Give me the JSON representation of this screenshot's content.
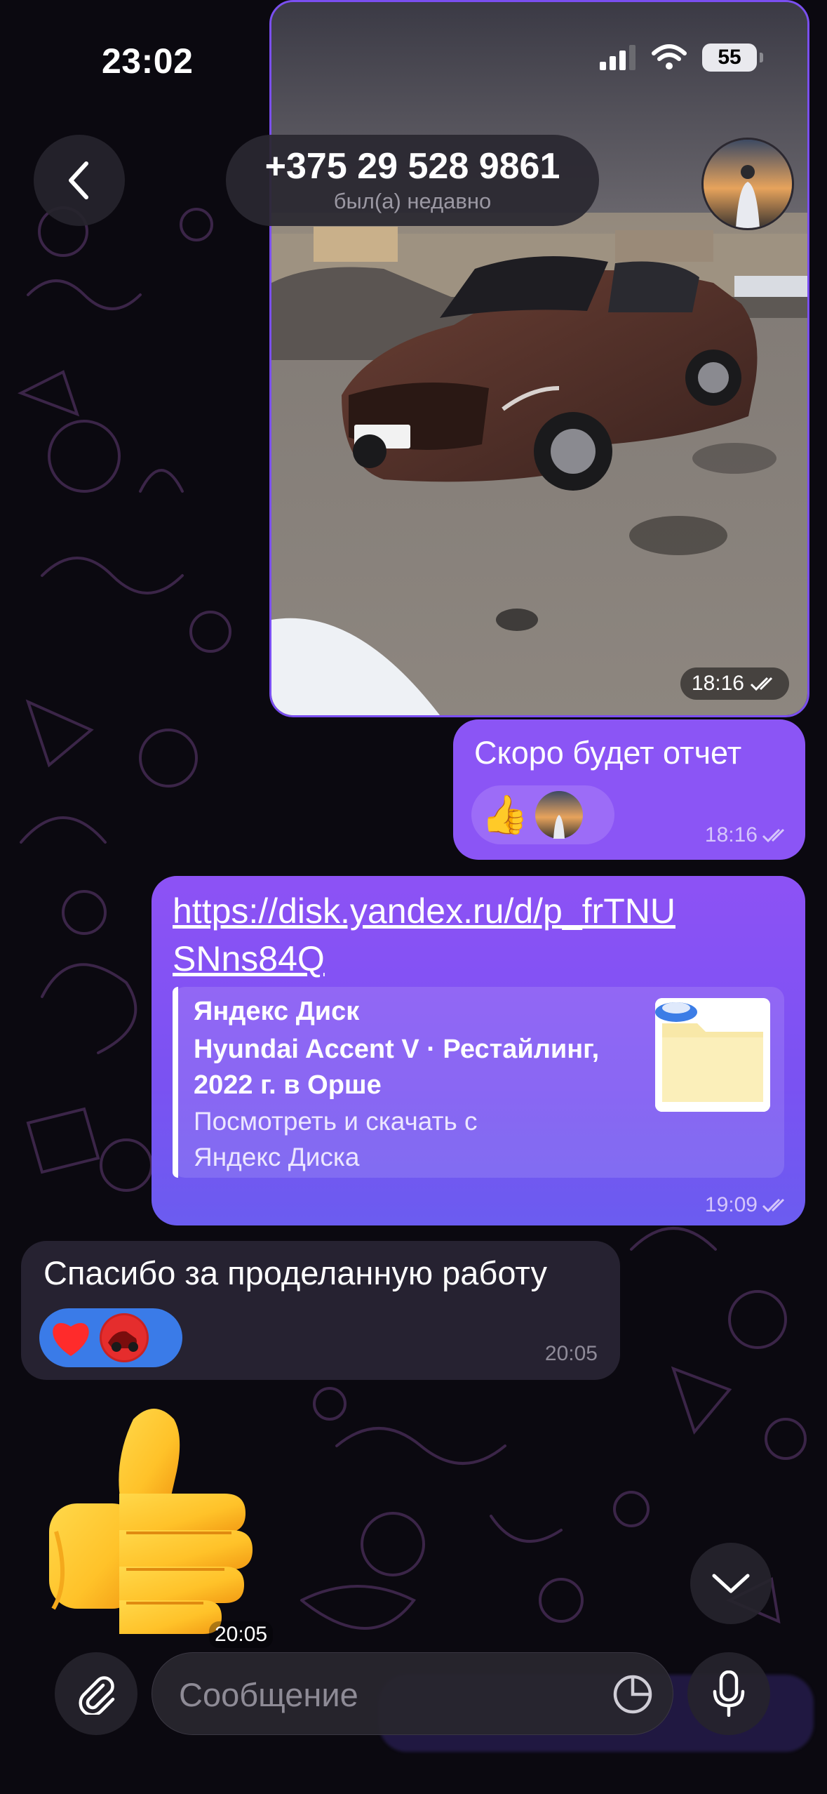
{
  "status_bar": {
    "time": "23:02",
    "battery": "55"
  },
  "header": {
    "contact_name": "+375 29 528 9861",
    "contact_status": "был(а) недавно"
  },
  "messages": [
    {
      "type": "photo",
      "direction": "outgoing",
      "time": "18:16",
      "read": true
    },
    {
      "type": "text",
      "direction": "outgoing",
      "text": "Скоро будет отчет",
      "time": "18:16",
      "read": true,
      "reactions": [
        "thumbs-up",
        "avatar"
      ]
    },
    {
      "type": "link",
      "direction": "outgoing",
      "text": "https://disk.yandex.ru/d/p_frTNUSNns84Q",
      "time": "19:09",
      "read": true,
      "preview": {
        "site": "Яндекс Диск",
        "title": "Hyundai Accent V · Рестайлинг, 2022 г. в Орше",
        "description": "Посмотреть и скачать с Яндекс Диска"
      }
    },
    {
      "type": "text",
      "direction": "incoming",
      "text": "Спасибо за проделанную работу",
      "time": "20:05",
      "reactions": [
        "heart",
        "avatar"
      ]
    },
    {
      "type": "sticker",
      "direction": "incoming",
      "sticker": "thumbs-up",
      "time": "20:05"
    }
  ],
  "input": {
    "placeholder": "Сообщение"
  },
  "colors": {
    "outgoing_bubble": "#8b55f5",
    "incoming_bubble": "#262231",
    "background": "#0b0910",
    "reaction_incoming": "#3a7be8"
  },
  "icons": {
    "back": "chevron-left-icon",
    "scroll_down": "chevron-down-icon",
    "attach": "paperclip-icon",
    "sticker": "sticker-icon",
    "mic": "microphone-icon"
  }
}
